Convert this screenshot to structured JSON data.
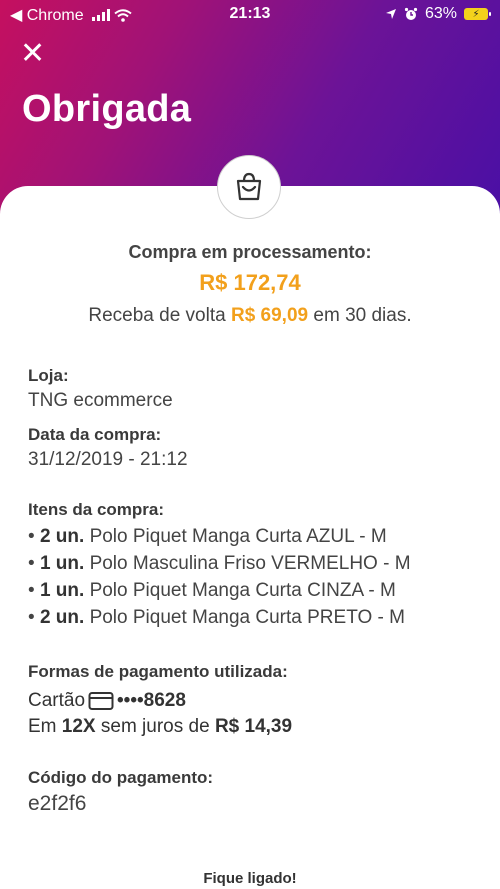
{
  "status_bar": {
    "back_app": "◀ Chrome",
    "time": "21:13",
    "battery": "63%"
  },
  "header": {
    "title": "Obrigada"
  },
  "summary": {
    "processing_label": "Compra em processamento:",
    "amount": "R$ 172,74",
    "cashback_prefix": "Receba de volta",
    "cashback_amount": "R$ 69,09",
    "cashback_suffix": "em 30 dias."
  },
  "store": {
    "label": "Loja:",
    "value": "TNG ecommerce"
  },
  "purchase_date": {
    "label": "Data da compra:",
    "value": "31/12/2019 - 21:12"
  },
  "items": {
    "label": "Itens da compra:",
    "list": [
      {
        "qty": "2 un.",
        "name": "Polo Piquet Manga Curta AZUL - M"
      },
      {
        "qty": "1 un.",
        "name": "Polo Masculina Friso VERMELHO - M"
      },
      {
        "qty": "1 un.",
        "name": "Polo Piquet Manga Curta CINZA - M"
      },
      {
        "qty": "2 un.",
        "name": "Polo Piquet Manga Curta PRETO - M"
      }
    ]
  },
  "payment": {
    "label": "Formas de pagamento utilizada:",
    "card_label": "Cartão",
    "card_number": "••••8628",
    "installments_prefix": "Em",
    "installments_count": "12X",
    "installments_middle": "sem juros de",
    "installments_value": "R$ 14,39"
  },
  "payment_code": {
    "label": "Código do pagamento:",
    "value": "e2f2f6"
  },
  "footer": {
    "text": "Fique ligado!"
  },
  "colors": {
    "gradient_start": "#c5105f",
    "gradient_end": "#4a0fa5",
    "accent": "#f2a01c"
  },
  "icons": [
    "close-icon",
    "shopping-bag-icon",
    "credit-card-icon",
    "wifi-icon",
    "location-icon",
    "alarm-icon",
    "battery-icon"
  ]
}
